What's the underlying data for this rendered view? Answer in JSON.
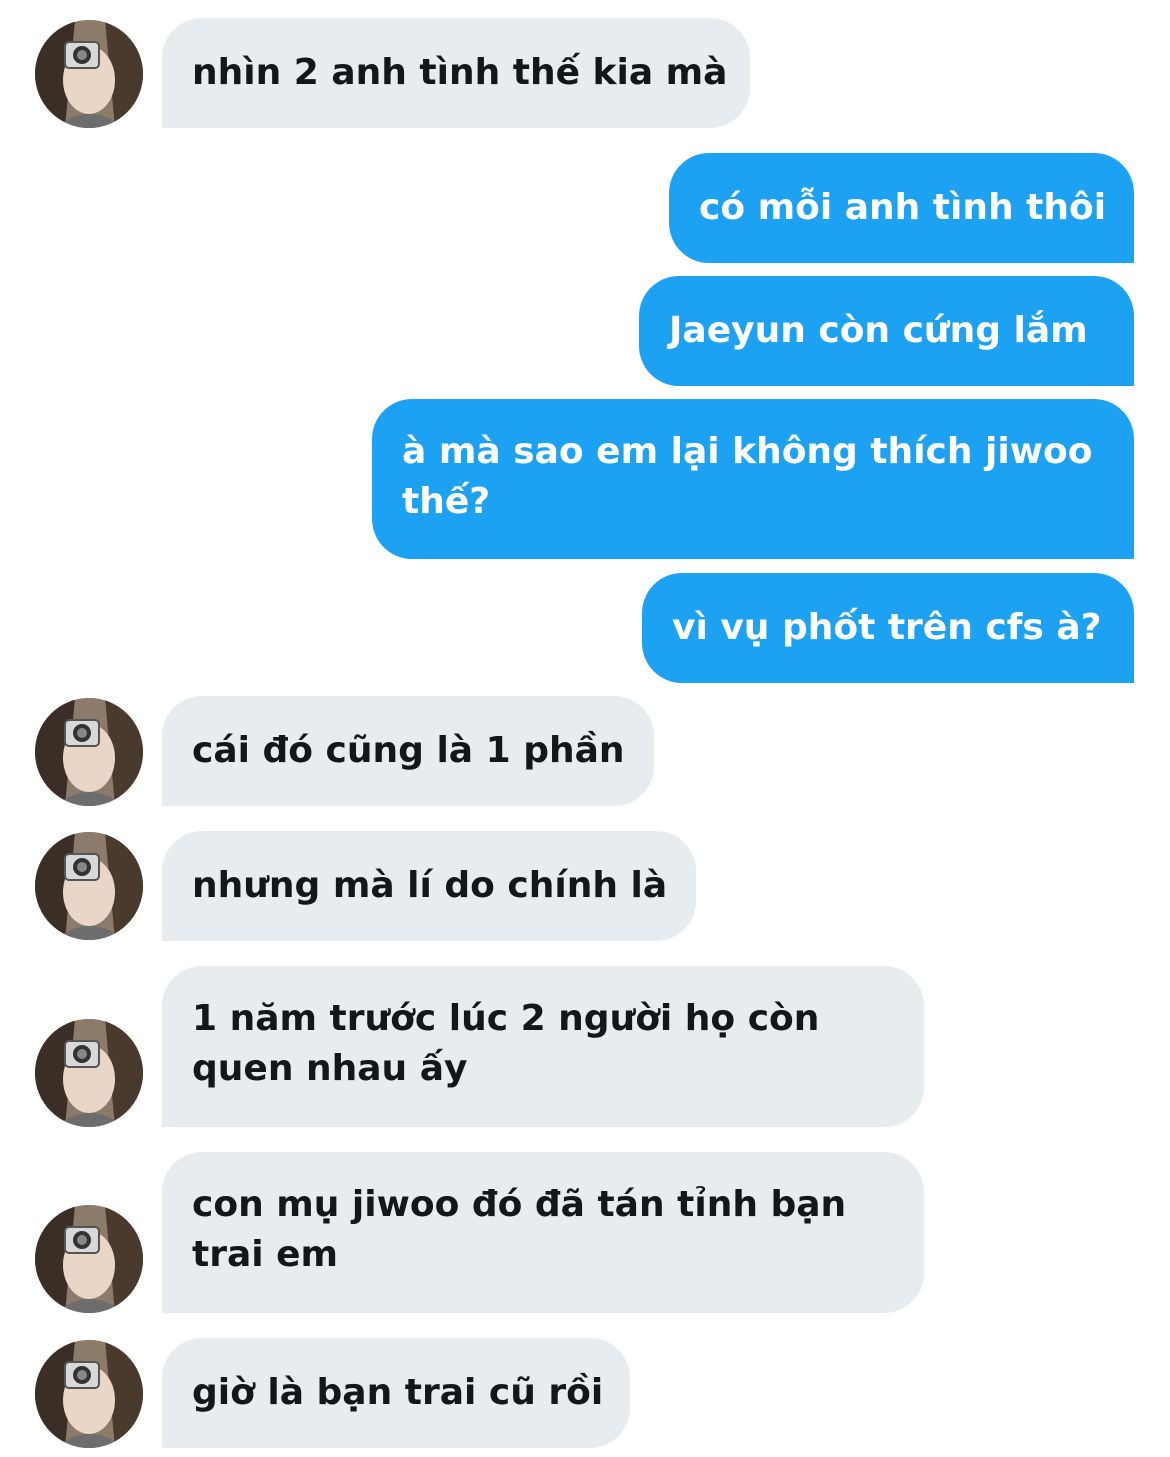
{
  "conversation": {
    "messages": [
      {
        "side": "in",
        "text": "nhìn 2 anh tình thế kia mà"
      },
      {
        "side": "out",
        "text": "có mỗi anh tình thôi"
      },
      {
        "side": "out",
        "text": "Jaeyun còn cứng lắm"
      },
      {
        "side": "out",
        "text": "à mà sao em lại không thích jiwoo thế?"
      },
      {
        "side": "out",
        "text": "vì vụ phốt trên cfs à?"
      },
      {
        "side": "in",
        "text": "cái đó cũng là 1 phần"
      },
      {
        "side": "in",
        "text": "nhưng mà lí do chính là"
      },
      {
        "side": "in",
        "text": "1 năm trước lúc 2 người họ còn quen nhau ấy"
      },
      {
        "side": "in",
        "text": "con mụ jiwoo đó đã tán tỉnh bạn trai em"
      },
      {
        "side": "in",
        "text": "giờ là bạn trai cũ rồi"
      }
    ]
  },
  "colors": {
    "incoming_bubble": "#e6ecf0",
    "outgoing_bubble": "#1da1f2",
    "incoming_text": "#14171a",
    "outgoing_text": "#ffffff"
  },
  "icons": {
    "avatar": "user-avatar-photo"
  }
}
